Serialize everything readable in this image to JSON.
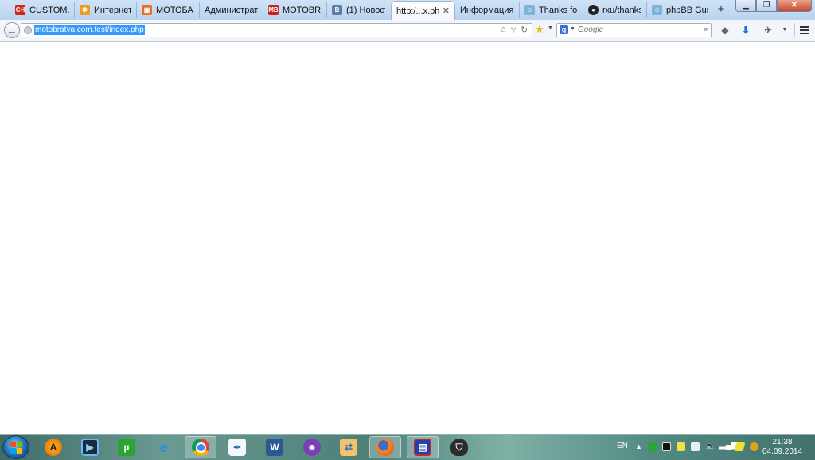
{
  "tabs": [
    {
      "label": "CUSTOM...",
      "icon": "ch-red-favicon-icon"
    },
    {
      "label": "Интернет-...",
      "icon": "joomla-favicon-icon"
    },
    {
      "label": "МОТОБА...",
      "icon": "orange-site-favicon-icon"
    },
    {
      "label": "Администрат...",
      "icon": "none"
    },
    {
      "label": "MOTOBR...",
      "icon": "mb-red-favicon-icon"
    },
    {
      "label": "(1) Новости",
      "icon": "vk-favicon-icon"
    },
    {
      "label": "http:/...x.php",
      "icon": "none",
      "active": true
    },
    {
      "label": "Информация",
      "icon": "none"
    },
    {
      "label": "Thanks for...",
      "icon": "phpbb-favicon-icon"
    },
    {
      "label": "rxu/thanks...",
      "icon": "github-favicon-icon"
    },
    {
      "label": "phpBB Gur...",
      "icon": "phpbb-favicon-icon"
    }
  ],
  "nav": {
    "url": "motobratva.com.test/index.php",
    "search_placeholder": "Google"
  },
  "taskbar": {
    "apps": [
      "avast-icon",
      "media-player-icon",
      "utorrent-icon",
      "internet-explorer-icon",
      "chrome-icon",
      "feather-app-icon",
      "word-icon",
      "purple-cat-app-icon",
      "file-transfer-icon",
      "firefox-icon",
      "save-disk-icon",
      "world-of-tanks-icon"
    ],
    "language": "EN",
    "time": "21:38",
    "date": "04.09.2014"
  },
  "colors": {
    "url_selection": "#3399ff",
    "taskbar": "#5a8f88"
  }
}
